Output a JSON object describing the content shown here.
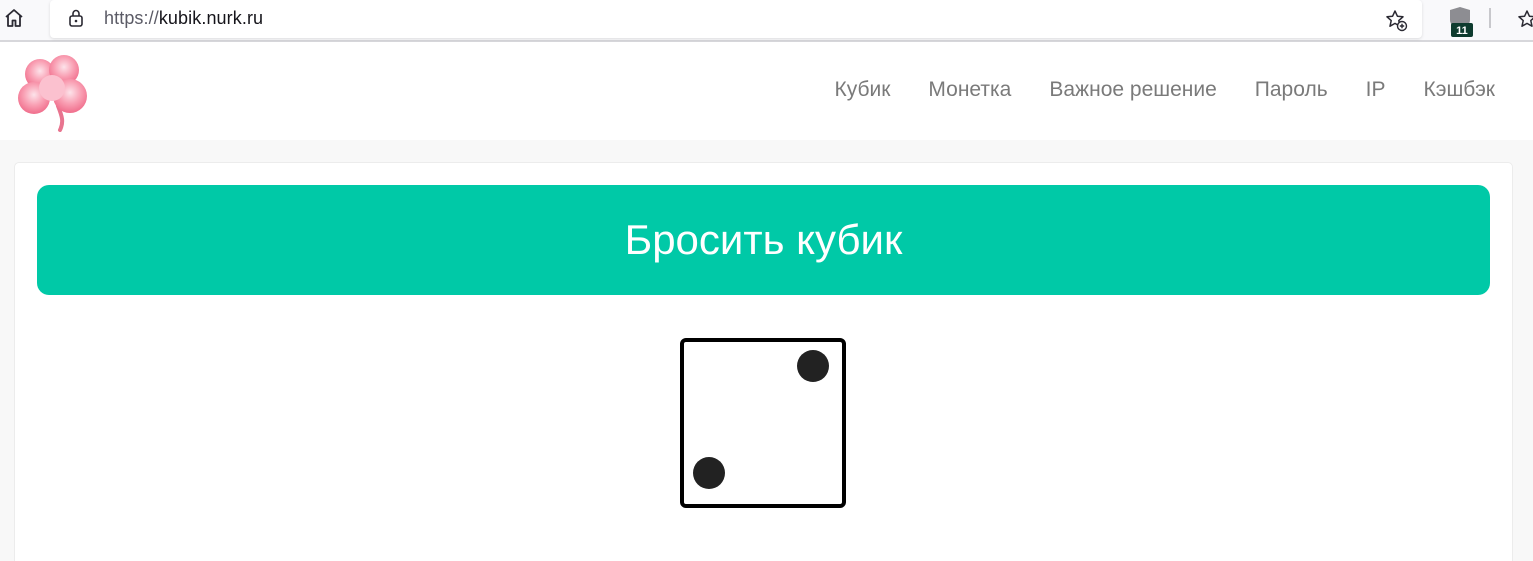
{
  "browser": {
    "url_scheme": "https://",
    "url_host": "kubik.nurk.ru",
    "extension_badge": "11"
  },
  "header": {
    "nav": [
      {
        "label": "Кубик"
      },
      {
        "label": "Монетка"
      },
      {
        "label": "Важное решение"
      },
      {
        "label": "Пароль"
      },
      {
        "label": "IP"
      },
      {
        "label": "Кэшбэк"
      }
    ]
  },
  "main": {
    "roll_button_label": "Бросить кубик",
    "die_value": 2
  },
  "colors": {
    "accent": "#00c9a7",
    "nav_text": "#7a7a7a",
    "pip": "#222222",
    "logo_pink": "#f7879d"
  }
}
